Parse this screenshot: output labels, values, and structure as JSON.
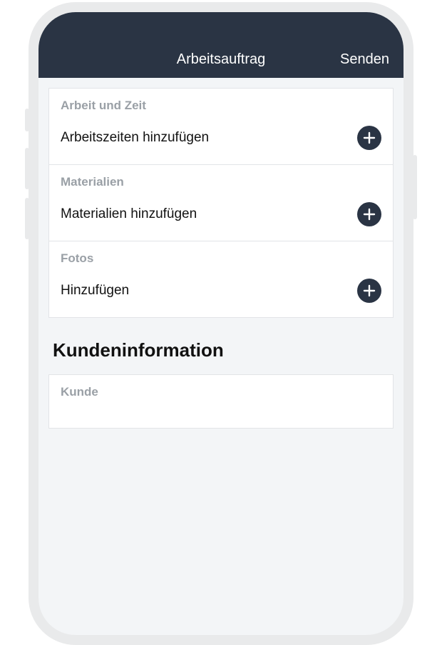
{
  "navbar": {
    "title": "Arbeitsauftrag",
    "action": "Senden"
  },
  "sections": {
    "work": {
      "header": "Arbeit und Zeit",
      "action_label": "Arbeitszeiten hinzufügen"
    },
    "materials": {
      "header": "Materialien",
      "action_label": "Materialien hinzufügen"
    },
    "photos": {
      "header": "Fotos",
      "action_label": "Hinzufügen"
    }
  },
  "customer": {
    "heading": "Kundeninformation",
    "field_label": "Kunde"
  }
}
